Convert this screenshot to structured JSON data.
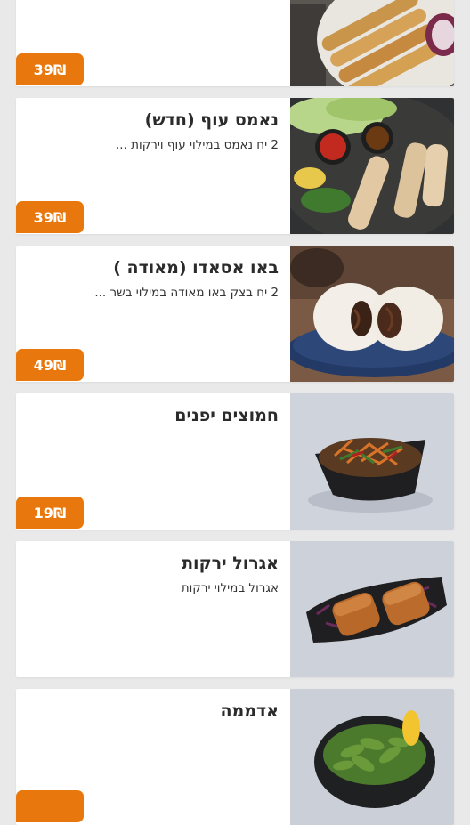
{
  "colors": {
    "page_background": "#e9e9e9",
    "card_background": "#ffffff",
    "price_badge": "#e8780d",
    "title_text": "#2b2b2b"
  },
  "menu_items": [
    {
      "title": "",
      "description": "",
      "price": "39₪",
      "image_icon": "spring-rolls-plate-photo"
    },
    {
      "title": "נאמס עוף (חדש)",
      "description": "2 יח נאמס במילוי עוף וירקות ...",
      "price": "39₪",
      "image_icon": "chicken-nems-platter-photo"
    },
    {
      "title": "באו אסאדו (מאודה )",
      "description": "2 יח בצק באו מאודה במילוי בשר ...",
      "price": "49₪",
      "image_icon": "steamed-bao-buns-photo"
    },
    {
      "title": "חמוצים יפנים",
      "description": "",
      "price": "19₪",
      "image_icon": "japanese-pickles-bowl-photo"
    },
    {
      "title": "אגרול ירקות",
      "description": "אגרול במילוי ירקות",
      "price": "",
      "image_icon": "vegetable-egg-rolls-photo"
    },
    {
      "title": "אדממה",
      "description": "",
      "price": "",
      "image_icon": "edamame-bowl-photo"
    }
  ]
}
